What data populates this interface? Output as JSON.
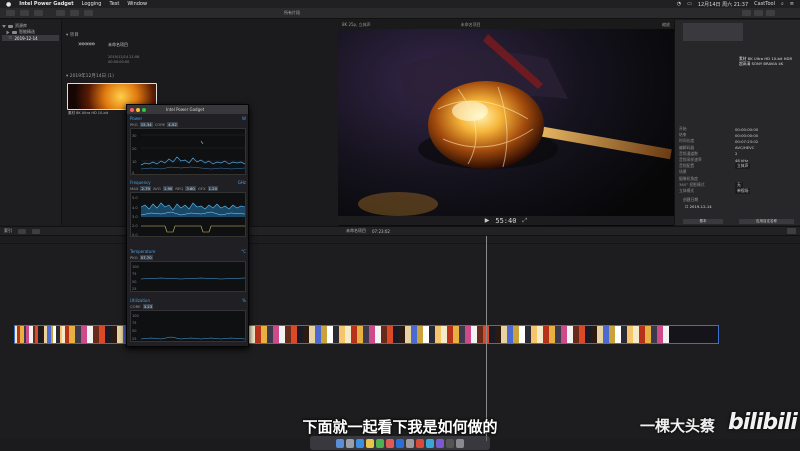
{
  "menubar": {
    "app_name": "Intel Power Gadget",
    "menus": [
      "Logging",
      "Test",
      "Window"
    ],
    "clock": "12月14日 周六 21:37",
    "status_app": "CastTool"
  },
  "toolbar": {
    "library_title": "所有片段",
    "viewer_title": "所有项目"
  },
  "library": {
    "root": "资源库",
    "smart": "智能精选",
    "event": "2019-12-14"
  },
  "browser": {
    "group1_label": "项目",
    "project_name": "未命名项目",
    "project_date": "2019/12/14 21:06",
    "project_duration": "00:00:00:00",
    "group2_label": "2019年12月14日",
    "group2_count": "(1)",
    "clip_label": "素材 8K Ultra HD 10-bit"
  },
  "viewer": {
    "resolution": "8K 25p, 立体声",
    "title": "未命名项目",
    "zoom": "缩放",
    "timecode": "55:40"
  },
  "inspector": {
    "clip_title": "素材 8K Ultra HD 10-bit HDR 超高清 SONY BRAVIA 4K",
    "rows": [
      {
        "key": "开始",
        "val": "00:00:00:00"
      },
      {
        "key": "结束",
        "val": "00:00:00:00"
      },
      {
        "key": "时间长度",
        "val": "00:07:23:02"
      },
      {
        "key": "编解码器",
        "val": "AVC/HEVC"
      },
      {
        "key": "音频通道数",
        "val": "2"
      },
      {
        "key": "音频采样速率",
        "val": "48 kHz"
      },
      {
        "key": "音频配置",
        "val": "立体声"
      },
      {
        "key": "场景",
        "val": ""
      },
      {
        "key": "摄像机角度",
        "val": ""
      },
      {
        "key": "360° 投影模式",
        "val": "无"
      },
      {
        "key": "立体模式",
        "val": "单视场"
      }
    ],
    "date_label": "创建日期",
    "date_value": "2019-12-14",
    "apply_button": "应用自定名称",
    "metadata_button": "基本"
  },
  "timeline": {
    "index_label": "索引",
    "project": "未命名项目",
    "duration": "07:23:02"
  },
  "gadget": {
    "title": "Intel Power Gadget",
    "power": {
      "label": "Power",
      "unit": "W",
      "pkg_label": "PKG",
      "pkg": "15.34",
      "core_label": "CORE",
      "core": "4.52",
      "axis": [
        30,
        25,
        20,
        15,
        10,
        5,
        0
      ]
    },
    "frequency": {
      "label": "Frequency",
      "unit": "GHz",
      "max_label": "MAX",
      "max": "2.79",
      "avg_label": "AVG",
      "avg": "1.90",
      "req_label": "REQ",
      "req": "3.60",
      "gfx_label": "GFX",
      "gfx": "1.20",
      "axis": [
        "5.0",
        "4.0",
        "3.0",
        "2.0",
        "1.0",
        "0.0"
      ]
    },
    "temperature": {
      "label": "Temperature",
      "unit": "°C",
      "pkg_label": "PKG",
      "pkg": "57.70",
      "axis": [
        100,
        75,
        50,
        25
      ]
    },
    "utilization": {
      "label": "Utilization",
      "unit": "%",
      "core_label": "CORE",
      "core": "3.23",
      "axis": [
        100,
        75,
        50,
        25
      ]
    }
  },
  "subtitle": "下面就一起看下我是如何做的",
  "watermark": {
    "name": "一棵大头蔡",
    "site": "bilibili"
  },
  "colors": {
    "accent": "#4a9fe0",
    "clip_border": "#3d6fd0"
  }
}
